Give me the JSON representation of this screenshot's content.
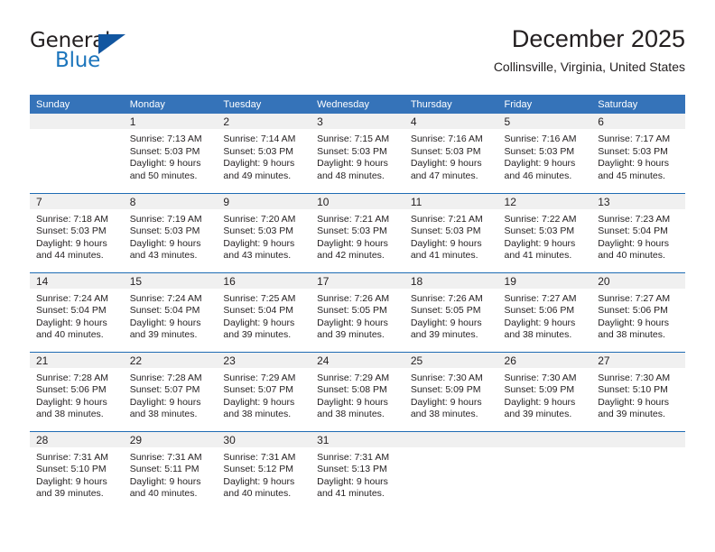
{
  "brand": {
    "name_part1": "General",
    "name_part2": "Blue",
    "logo_icon": "triangle-logo-icon"
  },
  "header": {
    "title": "December 2025",
    "subtitle": "Collinsville, Virginia, United States"
  },
  "calendar": {
    "day_headers": [
      "Sunday",
      "Monday",
      "Tuesday",
      "Wednesday",
      "Thursday",
      "Friday",
      "Saturday"
    ],
    "header_bg": "#3573b9",
    "row_divider": "#1f6cb4",
    "daynum_band_bg": "#f0f0f0",
    "weeks": [
      [
        {
          "day": "",
          "lines": []
        },
        {
          "day": "1",
          "lines": [
            "Sunrise: 7:13 AM",
            "Sunset: 5:03 PM",
            "Daylight: 9 hours",
            "and 50 minutes."
          ]
        },
        {
          "day": "2",
          "lines": [
            "Sunrise: 7:14 AM",
            "Sunset: 5:03 PM",
            "Daylight: 9 hours",
            "and 49 minutes."
          ]
        },
        {
          "day": "3",
          "lines": [
            "Sunrise: 7:15 AM",
            "Sunset: 5:03 PM",
            "Daylight: 9 hours",
            "and 48 minutes."
          ]
        },
        {
          "day": "4",
          "lines": [
            "Sunrise: 7:16 AM",
            "Sunset: 5:03 PM",
            "Daylight: 9 hours",
            "and 47 minutes."
          ]
        },
        {
          "day": "5",
          "lines": [
            "Sunrise: 7:16 AM",
            "Sunset: 5:03 PM",
            "Daylight: 9 hours",
            "and 46 minutes."
          ]
        },
        {
          "day": "6",
          "lines": [
            "Sunrise: 7:17 AM",
            "Sunset: 5:03 PM",
            "Daylight: 9 hours",
            "and 45 minutes."
          ]
        }
      ],
      [
        {
          "day": "7",
          "lines": [
            "Sunrise: 7:18 AM",
            "Sunset: 5:03 PM",
            "Daylight: 9 hours",
            "and 44 minutes."
          ]
        },
        {
          "day": "8",
          "lines": [
            "Sunrise: 7:19 AM",
            "Sunset: 5:03 PM",
            "Daylight: 9 hours",
            "and 43 minutes."
          ]
        },
        {
          "day": "9",
          "lines": [
            "Sunrise: 7:20 AM",
            "Sunset: 5:03 PM",
            "Daylight: 9 hours",
            "and 43 minutes."
          ]
        },
        {
          "day": "10",
          "lines": [
            "Sunrise: 7:21 AM",
            "Sunset: 5:03 PM",
            "Daylight: 9 hours",
            "and 42 minutes."
          ]
        },
        {
          "day": "11",
          "lines": [
            "Sunrise: 7:21 AM",
            "Sunset: 5:03 PM",
            "Daylight: 9 hours",
            "and 41 minutes."
          ]
        },
        {
          "day": "12",
          "lines": [
            "Sunrise: 7:22 AM",
            "Sunset: 5:03 PM",
            "Daylight: 9 hours",
            "and 41 minutes."
          ]
        },
        {
          "day": "13",
          "lines": [
            "Sunrise: 7:23 AM",
            "Sunset: 5:04 PM",
            "Daylight: 9 hours",
            "and 40 minutes."
          ]
        }
      ],
      [
        {
          "day": "14",
          "lines": [
            "Sunrise: 7:24 AM",
            "Sunset: 5:04 PM",
            "Daylight: 9 hours",
            "and 40 minutes."
          ]
        },
        {
          "day": "15",
          "lines": [
            "Sunrise: 7:24 AM",
            "Sunset: 5:04 PM",
            "Daylight: 9 hours",
            "and 39 minutes."
          ]
        },
        {
          "day": "16",
          "lines": [
            "Sunrise: 7:25 AM",
            "Sunset: 5:04 PM",
            "Daylight: 9 hours",
            "and 39 minutes."
          ]
        },
        {
          "day": "17",
          "lines": [
            "Sunrise: 7:26 AM",
            "Sunset: 5:05 PM",
            "Daylight: 9 hours",
            "and 39 minutes."
          ]
        },
        {
          "day": "18",
          "lines": [
            "Sunrise: 7:26 AM",
            "Sunset: 5:05 PM",
            "Daylight: 9 hours",
            "and 39 minutes."
          ]
        },
        {
          "day": "19",
          "lines": [
            "Sunrise: 7:27 AM",
            "Sunset: 5:06 PM",
            "Daylight: 9 hours",
            "and 38 minutes."
          ]
        },
        {
          "day": "20",
          "lines": [
            "Sunrise: 7:27 AM",
            "Sunset: 5:06 PM",
            "Daylight: 9 hours",
            "and 38 minutes."
          ]
        }
      ],
      [
        {
          "day": "21",
          "lines": [
            "Sunrise: 7:28 AM",
            "Sunset: 5:06 PM",
            "Daylight: 9 hours",
            "and 38 minutes."
          ]
        },
        {
          "day": "22",
          "lines": [
            "Sunrise: 7:28 AM",
            "Sunset: 5:07 PM",
            "Daylight: 9 hours",
            "and 38 minutes."
          ]
        },
        {
          "day": "23",
          "lines": [
            "Sunrise: 7:29 AM",
            "Sunset: 5:07 PM",
            "Daylight: 9 hours",
            "and 38 minutes."
          ]
        },
        {
          "day": "24",
          "lines": [
            "Sunrise: 7:29 AM",
            "Sunset: 5:08 PM",
            "Daylight: 9 hours",
            "and 38 minutes."
          ]
        },
        {
          "day": "25",
          "lines": [
            "Sunrise: 7:30 AM",
            "Sunset: 5:09 PM",
            "Daylight: 9 hours",
            "and 38 minutes."
          ]
        },
        {
          "day": "26",
          "lines": [
            "Sunrise: 7:30 AM",
            "Sunset: 5:09 PM",
            "Daylight: 9 hours",
            "and 39 minutes."
          ]
        },
        {
          "day": "27",
          "lines": [
            "Sunrise: 7:30 AM",
            "Sunset: 5:10 PM",
            "Daylight: 9 hours",
            "and 39 minutes."
          ]
        }
      ],
      [
        {
          "day": "28",
          "lines": [
            "Sunrise: 7:31 AM",
            "Sunset: 5:10 PM",
            "Daylight: 9 hours",
            "and 39 minutes."
          ]
        },
        {
          "day": "29",
          "lines": [
            "Sunrise: 7:31 AM",
            "Sunset: 5:11 PM",
            "Daylight: 9 hours",
            "and 40 minutes."
          ]
        },
        {
          "day": "30",
          "lines": [
            "Sunrise: 7:31 AM",
            "Sunset: 5:12 PM",
            "Daylight: 9 hours",
            "and 40 minutes."
          ]
        },
        {
          "day": "31",
          "lines": [
            "Sunrise: 7:31 AM",
            "Sunset: 5:13 PM",
            "Daylight: 9 hours",
            "and 41 minutes."
          ]
        },
        {
          "day": "",
          "lines": []
        },
        {
          "day": "",
          "lines": []
        },
        {
          "day": "",
          "lines": []
        }
      ]
    ]
  }
}
